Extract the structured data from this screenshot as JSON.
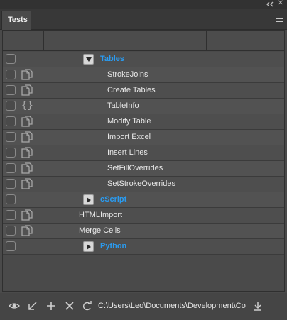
{
  "tab": {
    "label": "Tests"
  },
  "colors": {
    "group": "#2a9bf0",
    "background": "#4a4a4a"
  },
  "rows": [
    {
      "kind": "group",
      "expander": "collapse",
      "label": "Tables"
    },
    {
      "kind": "script",
      "icon": "script-file-icon",
      "label": "StrokeJoins"
    },
    {
      "kind": "script",
      "icon": "script-file-icon",
      "label": "Create Tables"
    },
    {
      "kind": "script",
      "icon": "braces-icon",
      "label": "TableInfo"
    },
    {
      "kind": "script",
      "icon": "script-file-icon",
      "label": "Modify Table"
    },
    {
      "kind": "script",
      "icon": "script-file-icon",
      "label": "Import Excel"
    },
    {
      "kind": "script",
      "icon": "script-file-icon",
      "label": "Insert Lines"
    },
    {
      "kind": "script",
      "icon": "script-file-icon",
      "label": "SetFillOverrides"
    },
    {
      "kind": "script",
      "icon": "script-file-icon",
      "label": "SetStrokeOverrides"
    },
    {
      "kind": "group",
      "expander": "expand",
      "label": "cScript"
    },
    {
      "kind": "script",
      "icon": "script-file-icon",
      "label": "HTMLImport"
    },
    {
      "kind": "script",
      "icon": "script-file-icon",
      "label": "Merge Cells"
    },
    {
      "kind": "group",
      "expander": "expand",
      "label": "Python"
    }
  ],
  "footer": {
    "path": "C:\\Users\\Leo\\Documents\\Development\\Co",
    "tools": [
      "eye-icon",
      "import-arrow-icon",
      "add-icon",
      "delete-icon",
      "refresh-icon"
    ],
    "download": "download-icon"
  }
}
